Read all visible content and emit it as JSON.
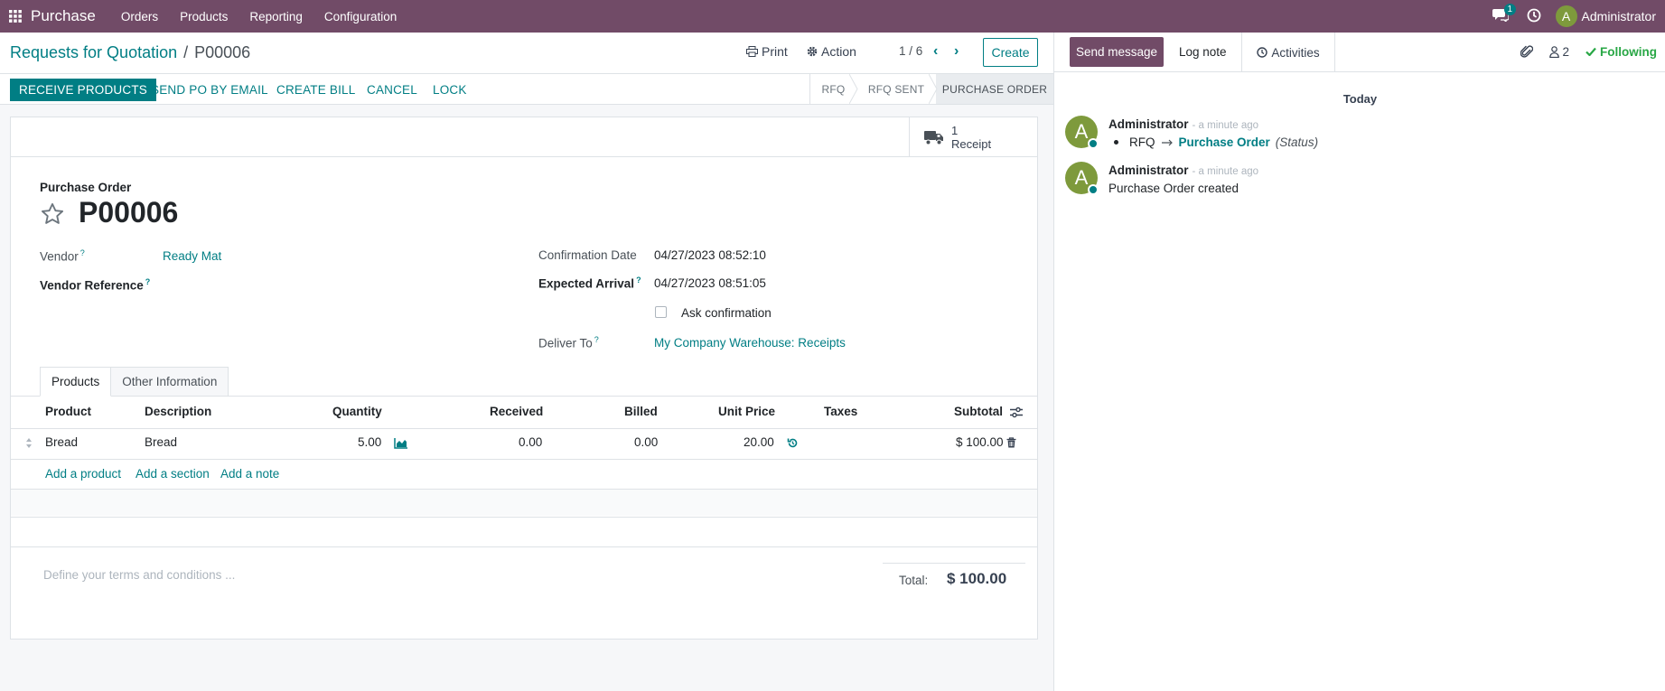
{
  "topbar": {
    "app_name": "Purchase",
    "menu": [
      "Orders",
      "Products",
      "Reporting",
      "Configuration"
    ],
    "chat_badge": "1",
    "user_initial": "A",
    "user_name": "Administrator"
  },
  "control_panel": {
    "breadcrumb_parent": "Requests for Quotation",
    "breadcrumb_separator": "/",
    "breadcrumb_current": "P00006",
    "print_label": "Print",
    "action_label": "Action",
    "pager": "1 / 6",
    "create_label": "Create"
  },
  "statusbar": {
    "buttons": [
      "RECEIVE PRODUCTS",
      "SEND PO BY EMAIL",
      "CREATE BILL",
      "CANCEL",
      "LOCK"
    ],
    "stages": [
      "RFQ",
      "RFQ SENT",
      "PURCHASE ORDER"
    ],
    "active_stage": "PURCHASE ORDER"
  },
  "smart_button": {
    "count": "1",
    "label": "Receipt",
    "icon": "truck-icon"
  },
  "form": {
    "doc_type": "Purchase Order",
    "name": "P00006",
    "vendor_label": "Vendor",
    "vendor_value": "Ready Mat",
    "vendor_ref_label": "Vendor Reference",
    "help_mark": "?",
    "confirmation_date_label": "Confirmation Date",
    "confirmation_date_value": "04/27/2023 08:52:10",
    "expected_arrival_label": "Expected Arrival",
    "expected_arrival_value": "04/27/2023 08:51:05",
    "ask_confirmation_label": "Ask confirmation",
    "deliver_to_label": "Deliver To",
    "deliver_to_value": "My Company Warehouse: Receipts"
  },
  "tabs": [
    "Products",
    "Other Information"
  ],
  "lines_table": {
    "headers": [
      "Product",
      "Description",
      "Quantity",
      "Received",
      "Billed",
      "Unit Price",
      "Taxes",
      "Subtotal"
    ],
    "rows": [
      {
        "product": "Bread",
        "description": "Bread",
        "quantity": "5.00",
        "received": "0.00",
        "billed": "0.00",
        "unit_price": "20.00",
        "taxes": "",
        "subtotal": "$ 100.00"
      }
    ],
    "add_links": [
      "Add a product",
      "Add a section",
      "Add a note"
    ]
  },
  "footer": {
    "terms_placeholder": "Define your terms and conditions ...",
    "total_label": "Total:",
    "total_value": "$ 100.00"
  },
  "chatter": {
    "send_message_label": "Send message",
    "log_note_label": "Log note",
    "activities_label": "Activities",
    "followers_count": "2",
    "following_label": "Following",
    "date_separator": "Today",
    "messages": [
      {
        "avatar": "A",
        "author": "Administrator",
        "time": "- a minute ago",
        "track_from": "RFQ",
        "track_to": "Purchase Order",
        "track_field": "(Status)"
      },
      {
        "avatar": "A",
        "author": "Administrator",
        "time": "- a minute ago",
        "body": "Purchase Order created"
      }
    ]
  },
  "colors": {
    "brand": "#714b67",
    "accent": "#017e84",
    "success": "#28a745"
  }
}
